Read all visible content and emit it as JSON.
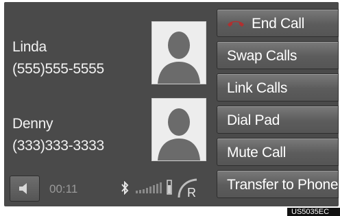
{
  "callers": [
    {
      "name": "Linda",
      "number": "(555)555-5555"
    },
    {
      "name": "Denny",
      "number": "(333)333-3333"
    }
  ],
  "buttons": {
    "end_call": "End Call",
    "swap_calls": "Swap Calls",
    "link_calls": "Link Calls",
    "dial_pad": "Dial Pad",
    "mute_call": "Mute Call",
    "transfer": "Transfer to Phone"
  },
  "status": {
    "timer": "00:11",
    "roaming_letter": "R"
  },
  "image_code": "US5035EC",
  "colors": {
    "screen_bg": "#4a4a4a",
    "button_bg": "#5c5c5c",
    "end_call_icon": "#b03030",
    "timer_text": "#9a9a9a"
  },
  "icons": {
    "end_call": "phone-hangup-icon",
    "speaker": "speaker-icon",
    "bluetooth": "bluetooth-icon",
    "signal": "signal-strength-icon",
    "battery": "battery-icon",
    "roaming": "roaming-icon",
    "contact": "contact-silhouette-icon"
  }
}
